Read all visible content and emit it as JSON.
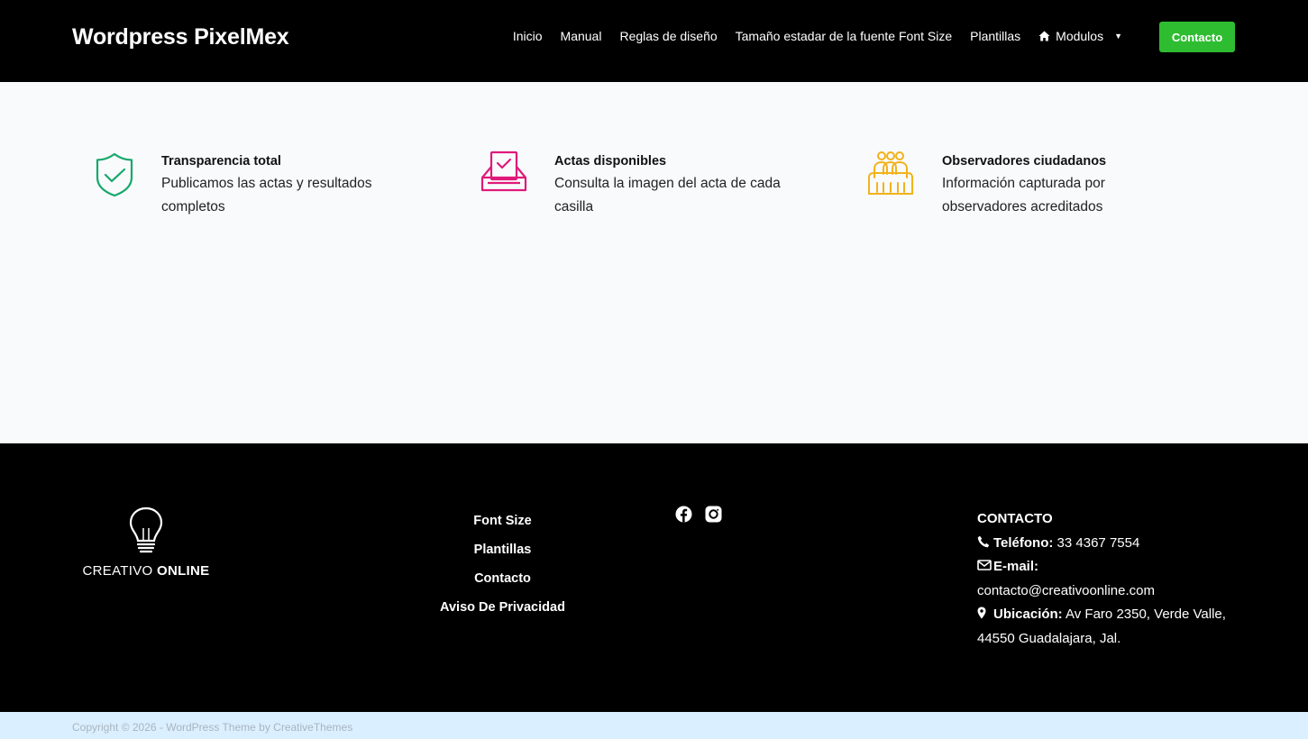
{
  "header": {
    "brand": "Wordpress PixelMex",
    "nav": [
      "Inicio",
      "Manual",
      "Reglas de diseño",
      "Tamaño estadar de la fuente Font Size",
      "Plantillas"
    ],
    "modulos_label": "Modulos",
    "contact_button": "Contacto"
  },
  "features": [
    {
      "title": "Transparencia total",
      "desc": "Publicamos las actas y resultados completos",
      "icon": "shield-check-icon",
      "color": "#14a86b"
    },
    {
      "title": "Actas disponibles",
      "desc": "Consulta la imagen del acta de cada casilla",
      "icon": "ballot-box-icon",
      "color": "#e0197a"
    },
    {
      "title": "Observadores ciudadanos",
      "desc": "Información capturada por observadores acreditados",
      "icon": "observers-icon",
      "color": "#f2b21a"
    }
  ],
  "footer": {
    "logo_text_light": "CREATIVO ",
    "logo_text_bold": "ONLINE",
    "links": [
      "Font Size",
      "Plantillas",
      "Contacto",
      "Aviso De Privacidad"
    ],
    "social": [
      "facebook-icon",
      "instagram-icon"
    ],
    "contact": {
      "heading": "CONTACTO",
      "phone_label": "Teléfono:",
      "phone_value": " 33 4367 7554",
      "email_label": "E-mail:",
      "email_value": "contacto@creativoonline.com",
      "location_label": "Ubicación:",
      "location_value": " Av Faro 2350, Verde Valle, 44550 Guadalajara, Jal."
    }
  },
  "copyright": "Copyright © 2026 - WordPress Theme by CreativeThemes",
  "colors": {
    "accent_green": "#2ebd31",
    "footer_bottom": "#daefff"
  }
}
